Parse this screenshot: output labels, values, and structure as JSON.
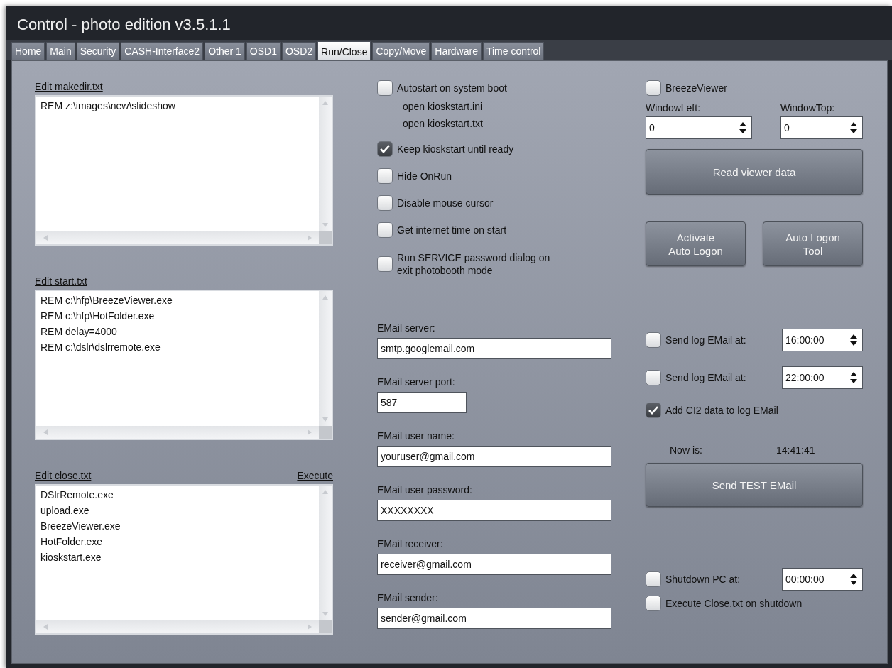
{
  "window": {
    "title": "Control - photo edition v3.5.1.1"
  },
  "tabs": [
    {
      "label": "Home",
      "selected": false
    },
    {
      "label": "Main",
      "selected": false
    },
    {
      "label": "Security",
      "selected": false
    },
    {
      "label": "CASH-Interface2",
      "selected": false
    },
    {
      "label": "Other 1",
      "selected": false
    },
    {
      "label": "OSD1",
      "selected": false
    },
    {
      "label": "OSD2",
      "selected": false
    },
    {
      "label": "Run/Close",
      "selected": true
    },
    {
      "label": "Copy/Move",
      "selected": false
    },
    {
      "label": "Hardware",
      "selected": false
    },
    {
      "label": "Time control",
      "selected": false
    }
  ],
  "editors": [
    {
      "label": "Edit makedir.txt",
      "lines": [
        "REM z:\\images\\new\\slideshow"
      ]
    },
    {
      "label": "Edit start.txt",
      "lines": [
        "REM c:\\hfp\\BreezeViewer.exe",
        "REM c:\\hfp\\HotFolder.exe",
        "REM delay=4000",
        "REM c:\\dslr\\dslrremote.exe"
      ]
    },
    {
      "label": "Edit close.txt",
      "action": "Execute",
      "lines": [
        "DSlrRemote.exe",
        "upload.exe",
        "BreezeViewer.exe",
        "HotFolder.exe",
        "kioskstart.exe"
      ]
    }
  ],
  "options": [
    {
      "kind": "checkbox",
      "label": "Autostart on system boot",
      "checked": false
    },
    {
      "kind": "link",
      "label": "open kioskstart.ini"
    },
    {
      "kind": "link",
      "label": "open kioskstart.txt"
    },
    {
      "kind": "checkbox",
      "label": "Keep kioskstart until ready",
      "checked": true
    },
    {
      "kind": "checkbox",
      "label": "Hide OnRun",
      "checked": false
    },
    {
      "kind": "checkbox",
      "label": "Disable mouse cursor",
      "checked": false
    },
    {
      "kind": "checkbox",
      "label": "Get internet time on start",
      "checked": false
    },
    {
      "kind": "checkbox",
      "label": "Run SERVICE password dialog on exit photobooth mode",
      "checked": false
    }
  ],
  "email_fields": [
    {
      "label": "EMail server:",
      "value": "smtp.googlemail.com"
    },
    {
      "label": "EMail server port:",
      "value": "587",
      "kind": "short"
    },
    {
      "label": "EMail user name:",
      "value": "youruser@gmail.com"
    },
    {
      "label": "EMail user password:",
      "value": "XXXXXXXX"
    },
    {
      "label": "EMail receiver:",
      "value": "receiver@gmail.com"
    },
    {
      "label": "EMail sender:",
      "value": "sender@gmail.com"
    }
  ],
  "viewer": {
    "checkbox": {
      "label": "BreezeViewer",
      "checked": false
    },
    "spinners": [
      {
        "label": "WindowLeft:",
        "value": "0"
      },
      {
        "label": "WindowTop:",
        "value": "0"
      }
    ],
    "read_button": "Read viewer data",
    "logon_buttons": [
      "Activate\nAuto Logon",
      "Auto Logon\nTool"
    ]
  },
  "log_email": [
    {
      "label": "Send log EMail at:",
      "checked": false,
      "time": "16:00:00"
    },
    {
      "label": "Send log EMail at:",
      "checked": false,
      "time": "22:00:00"
    }
  ],
  "add_ci2": {
    "label": "Add CI2 data to log EMail",
    "checked": true
  },
  "now": {
    "label": "Now is:",
    "time": "14:41:41"
  },
  "test_button": "Send TEST EMail",
  "shutdown": {
    "label": "Shutdown PC at:",
    "checked": false,
    "time": "00:00:00"
  },
  "execute_close": {
    "label": "Execute Close.txt on shutdown",
    "checked": false
  }
}
